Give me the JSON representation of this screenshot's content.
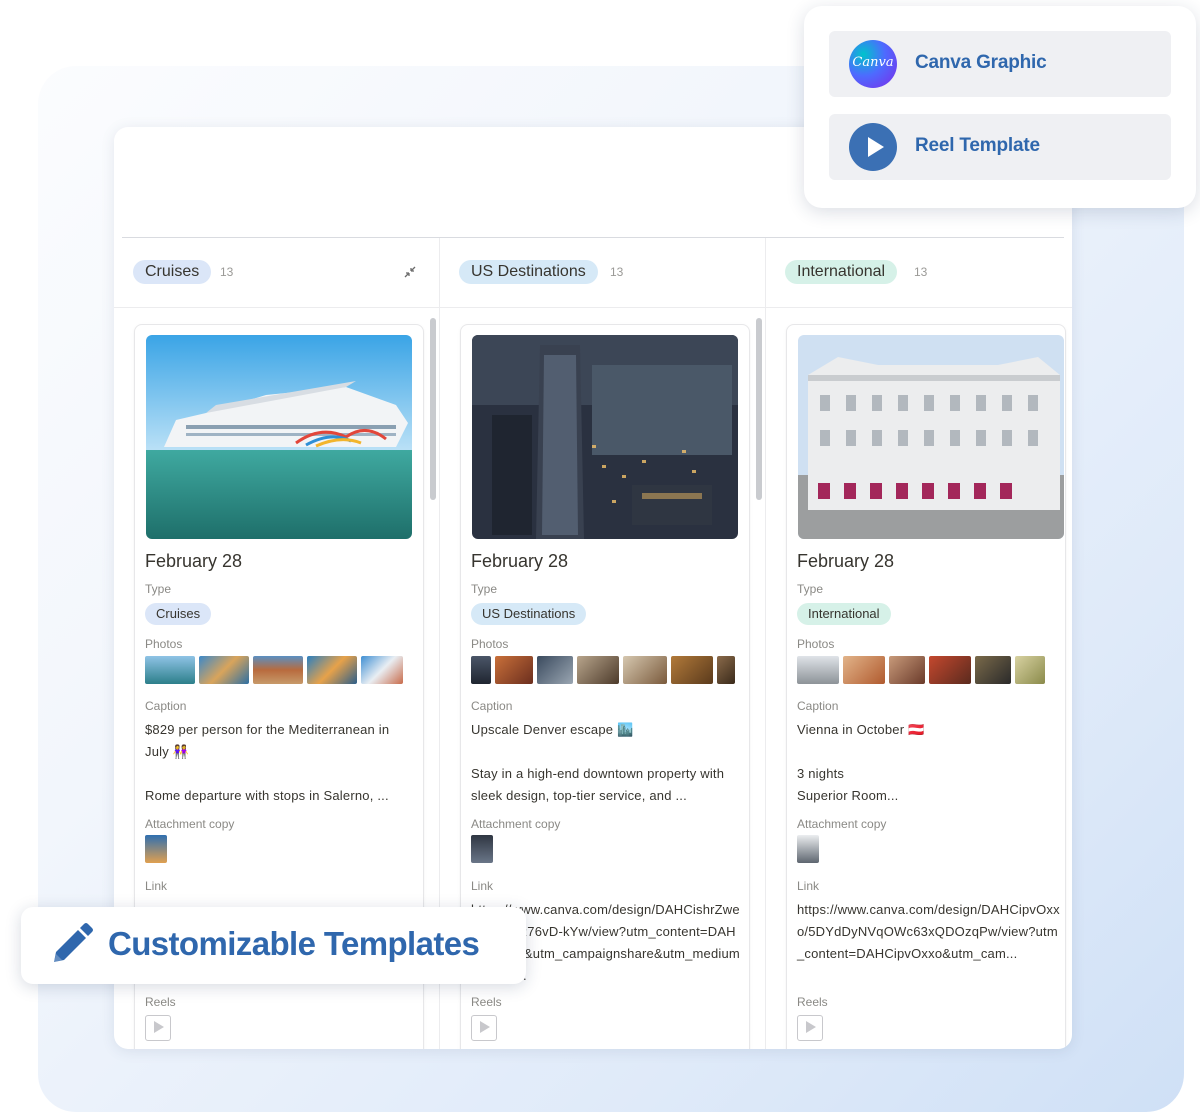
{
  "popup": {
    "items": [
      {
        "label": "Canva Graphic",
        "icon": "canva-logo-icon",
        "logo_text": "Canva"
      },
      {
        "label": "Reel Template",
        "icon": "play-icon"
      }
    ]
  },
  "callout": {
    "label": "Customizable Templates",
    "icon": "pencil-icon"
  },
  "columns": [
    {
      "group": "Cruises",
      "count": "13",
      "card": {
        "title": "February 28",
        "type_label": "Type",
        "type_value": "Cruises",
        "photos_label": "Photos",
        "caption_label": "Caption",
        "caption_line1": "$829 per person for the Mediterranean in July 👭",
        "caption_line2": "Rome departure with stops in Salerno, ...",
        "attachment_label": "Attachment copy",
        "link_label": "Link",
        "link_value": "",
        "reels_label": "Reels"
      }
    },
    {
      "group": "US Destinations",
      "count": "13",
      "card": {
        "title": "February 28",
        "type_label": "Type",
        "type_value": "US Destinations",
        "photos_label": "Photos",
        "caption_label": "Caption",
        "caption_line1": "Upscale Denver escape 🏙️",
        "caption_line2": "Stay in a high-end downtown property with sleek design, top-tier service, and ...",
        "attachment_label": "Attachment copy",
        "link_label": "Link",
        "link_value": "https://www.canva.com/design/DAHCishrZweegreMKR76vD-kYw/view?utm_content=DAHCishrk30&utm_campaignshare&utm_medium=link&u...",
        "reels_label": "Reels"
      }
    },
    {
      "group": "International",
      "count": "13",
      "card": {
        "title": "February 28",
        "type_label": "Type",
        "type_value": "International",
        "photos_label": "Photos",
        "caption_label": "Caption",
        "caption_line1": "Vienna in October 🇦🇹",
        "caption_line2": "3 nights\nSuperior Room...",
        "attachment_label": "Attachment copy",
        "link_label": "Link",
        "link_value": "https://www.canva.com/design/DAHCipvOxxo/5DYdDyNVqOWc63xQDOzqPw/view?utm_content=DAHCipvOxxo&utm_cam...",
        "reels_label": "Reels"
      }
    }
  ],
  "colors": {
    "accent": "#2f67ad",
    "pill_cruises": "#dbe6f8",
    "pill_us": "#d6e9f7",
    "pill_international": "#d6f1e8"
  }
}
